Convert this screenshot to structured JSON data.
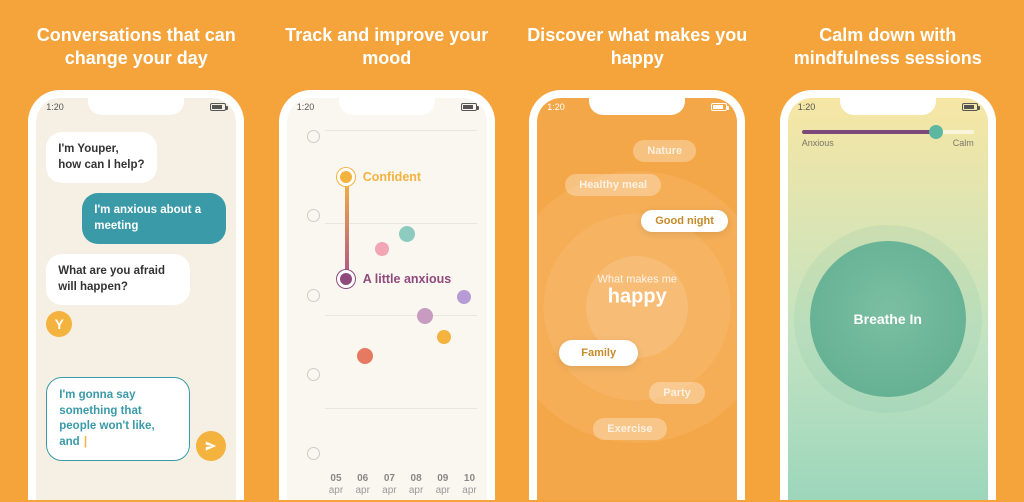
{
  "status_time": "1:20",
  "panels": [
    {
      "title": "Conversations that can change your day",
      "chat": {
        "bot1": "I'm Youper,\nhow can I help?",
        "user1": "I'm anxious about a meeting",
        "bot2": "What are you afraid will happen?",
        "avatar_letter": "Y",
        "input": "I'm gonna say something that people won't like, and "
      }
    },
    {
      "title": "Track and improve your mood",
      "chart": {
        "label_top": "Confident",
        "label_mid": "A little anxious",
        "x_days": [
          "05",
          "06",
          "07",
          "08",
          "09",
          "10"
        ],
        "x_month": "apr"
      }
    },
    {
      "title": "Discover what makes you happy",
      "happy": {
        "line1": "What makes me",
        "line2": "happy",
        "chips": {
          "nature": "Nature",
          "healthy": "Healthy meal",
          "goodnight": "Good night",
          "family": "Family",
          "party": "Party",
          "exercise": "Exercise"
        }
      }
    },
    {
      "title": "Calm down with mindfulness sessions",
      "breathe": {
        "left": "Anxious",
        "right": "Calm",
        "center": "Breathe In"
      }
    }
  ]
}
